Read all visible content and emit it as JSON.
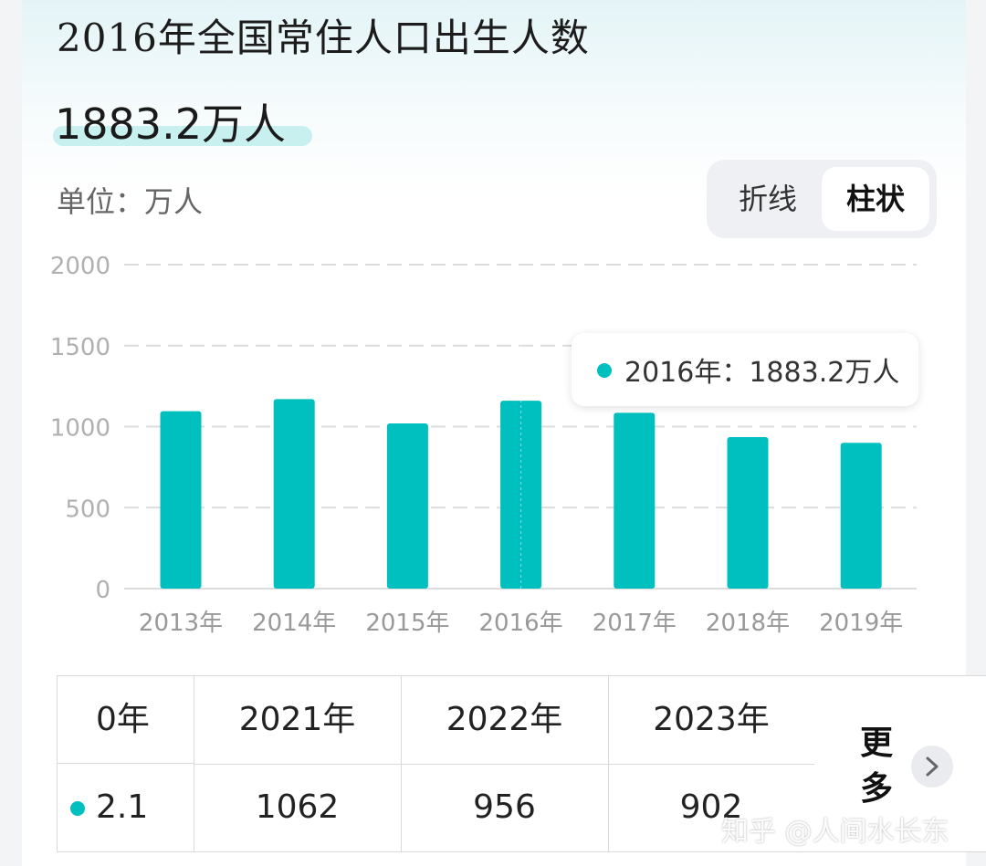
{
  "header": {
    "title": "2016年全国常住人口出生人数",
    "value": "1883.2万人",
    "unit_label": "单位：万人"
  },
  "toggle": {
    "line_label": "折线",
    "bar_label": "柱状",
    "selected": "柱状"
  },
  "tooltip": {
    "text": "2016年：1883.2万人"
  },
  "colors": {
    "accent": "#00bfbf",
    "grid": "#dcdcdc",
    "tick": "#999999"
  },
  "chart_data": {
    "type": "bar",
    "categories": [
      "2013年",
      "2014年",
      "2015年",
      "2016年",
      "2017年",
      "2018年",
      "2019年"
    ],
    "values": [
      1095,
      1170,
      1020,
      1160,
      1085,
      935,
      900
    ],
    "ylim": [
      0,
      2000
    ],
    "yticks": [
      0,
      500,
      1000,
      1500,
      2000
    ],
    "grid": true,
    "highlighted_category": "2016年"
  },
  "table": {
    "columns": [
      {
        "header": "0年",
        "value": "2.1"
      },
      {
        "header": "2021年",
        "value": "1062"
      },
      {
        "header": "2022年",
        "value": "956"
      },
      {
        "header": "2023年",
        "value": "902"
      }
    ],
    "more_label": "更多"
  },
  "watermark": "知乎 @人间水长东"
}
